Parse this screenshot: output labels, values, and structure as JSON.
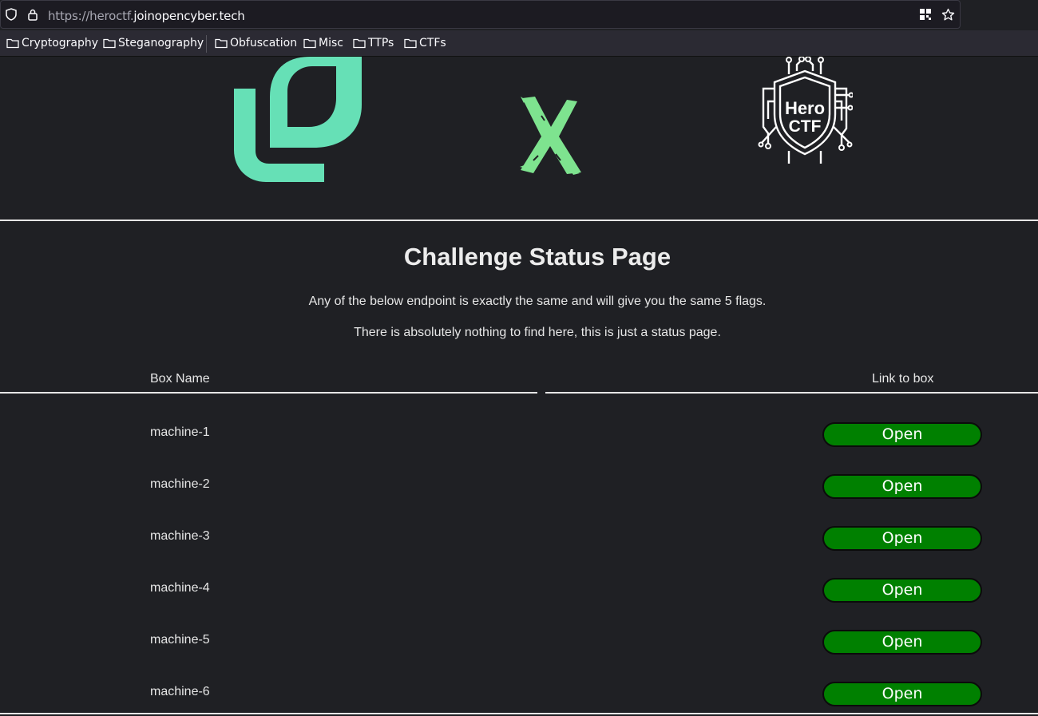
{
  "browser": {
    "url_prefix": "https://heroctf.",
    "url_domain": "joinopencyber.tech",
    "bookmarks": [
      {
        "label": "Cryptography"
      },
      {
        "label": "Steganography"
      },
      {
        "label": "Obfuscation"
      },
      {
        "label": "Misc"
      },
      {
        "label": "TTPs"
      },
      {
        "label": "CTFs"
      }
    ]
  },
  "logos": {
    "hero_top": "Hero",
    "hero_bottom": "CTF"
  },
  "page": {
    "title": "Challenge Status Page",
    "paragraph1": "Any of the below endpoint is exactly the same and will give you the same 5 flags.",
    "paragraph2": "There is absolutely nothing to find here, this is just a status page.",
    "table": {
      "col_name": "Box Name",
      "col_link": "Link to box",
      "rows": [
        {
          "name": "machine-1",
          "action": "Open"
        },
        {
          "name": "machine-2",
          "action": "Open"
        },
        {
          "name": "machine-3",
          "action": "Open"
        },
        {
          "name": "machine-4",
          "action": "Open"
        },
        {
          "name": "machine-5",
          "action": "Open"
        },
        {
          "name": "machine-6",
          "action": "Open"
        }
      ]
    }
  },
  "colors": {
    "page_bg": "#1f2024",
    "button_green": "#008000",
    "logo_mint": "#66e0b6"
  }
}
